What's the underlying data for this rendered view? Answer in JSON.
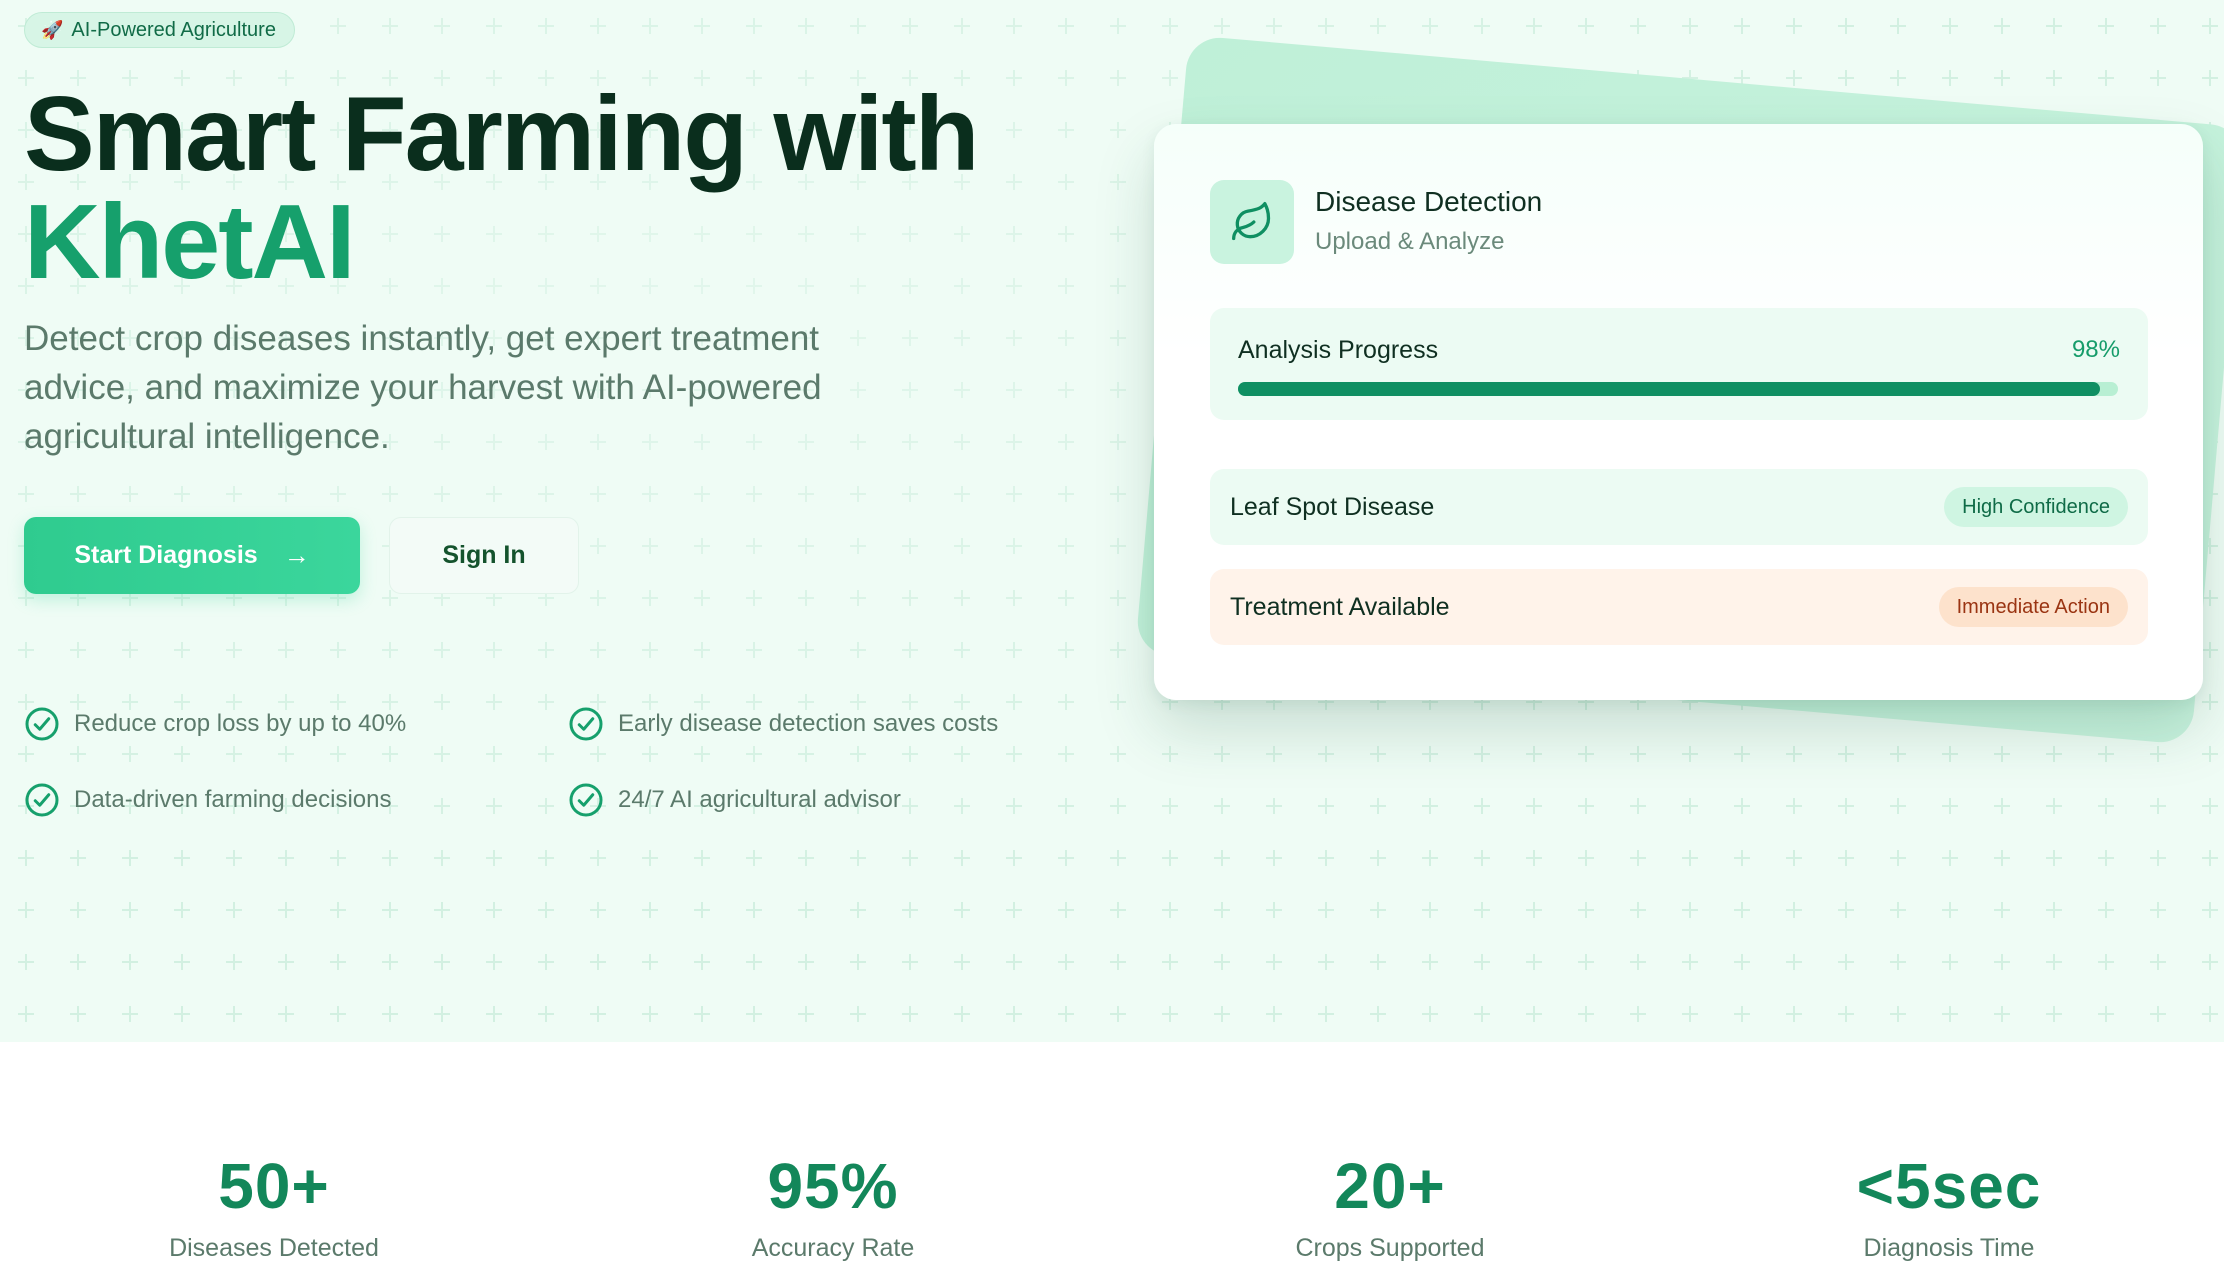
{
  "badge": {
    "icon": "rocket-icon",
    "label": "AI-Powered Agriculture"
  },
  "hero": {
    "title_line1": "Smart Farming with",
    "title_line2": "KhetAI",
    "subtitle": "Detect crop diseases instantly, get expert treatment advice, and maximize your harvest with AI-powered agricultural intelligence.",
    "primary_button": "Start Diagnosis",
    "secondary_button": "Sign In"
  },
  "features": [
    {
      "icon": "check-circle-icon",
      "text": "Reduce crop loss by up to 40%"
    },
    {
      "icon": "check-circle-icon",
      "text": "Early disease detection saves costs"
    },
    {
      "icon": "check-circle-icon",
      "text": "Data-driven farming decisions"
    },
    {
      "icon": "check-circle-icon",
      "text": "24/7 AI agricultural advisor"
    }
  ],
  "card": {
    "icon": "leaf-icon",
    "title": "Disease Detection",
    "subtitle": "Upload & Analyze",
    "progress_label": "Analysis Progress",
    "progress_text": "98%",
    "progress_value": 0.98,
    "results": [
      {
        "label": "Leaf Spot Disease",
        "badge": "High Confidence"
      },
      {
        "label": "Treatment Available",
        "badge": "Immediate Action"
      }
    ]
  },
  "stats": [
    {
      "value": "50+",
      "label": "Diseases Detected"
    },
    {
      "value": "95%",
      "label": "Accuracy Rate"
    },
    {
      "value": "20+",
      "label": "Crops Supported"
    },
    {
      "value": "<5sec",
      "label": "Diagnosis Time"
    }
  ],
  "colors": {
    "brand": "#16a06c",
    "primary_button": "#34d399",
    "stat_number": "#13875a",
    "warning_badge": "#9a3412"
  }
}
